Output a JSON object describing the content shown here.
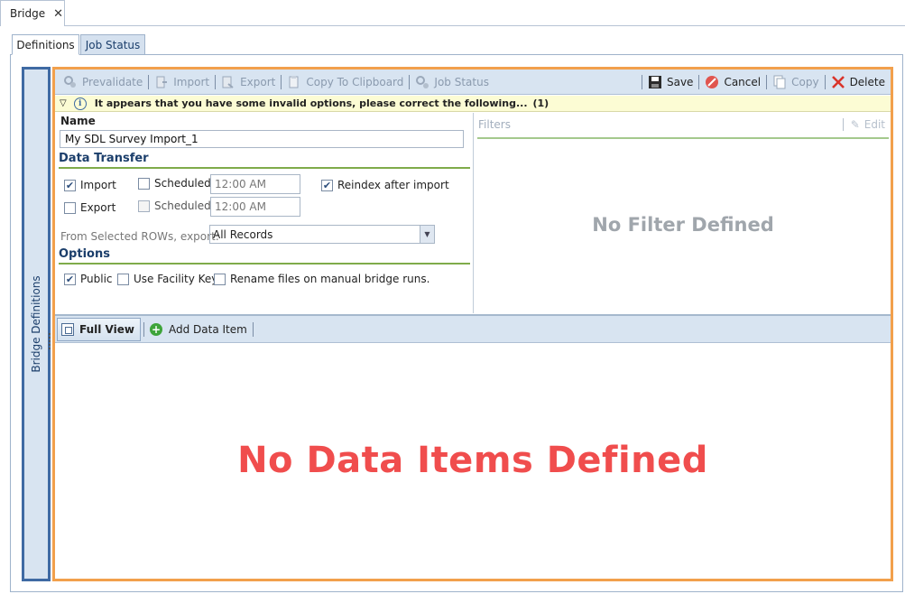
{
  "doc_tab": {
    "label": "Bridge",
    "close": "✕"
  },
  "sub_tabs": [
    {
      "label": "Definitions",
      "active": true
    },
    {
      "label": "Job Status",
      "active": false
    }
  ],
  "side_panel": {
    "label": "Bridge Definitions"
  },
  "toolbar": {
    "prevalidate": "Prevalidate",
    "import": "Import",
    "export": "Export",
    "copy_clipboard": "Copy To Clipboard",
    "job_status": "Job Status",
    "save": "Save",
    "cancel": "Cancel",
    "copy": "Copy",
    "delete": "Delete"
  },
  "warning": {
    "message": "It appears that you have some invalid options, please correct the following...",
    "count": "(1)"
  },
  "form": {
    "name_label": "Name",
    "name_value": "My SDL Survey Import_1",
    "data_transfer_header": "Data Transfer",
    "import_label": "Import",
    "import_checked": true,
    "export_label": "Export",
    "export_checked": false,
    "scheduled_label": "Scheduled",
    "scheduled_1_checked": false,
    "scheduled_2_checked": false,
    "time_1": "12:00 AM",
    "time_2": "12:00 AM",
    "reindex_label": "Reindex after import",
    "reindex_checked": true,
    "selected_rows_label": "From Selected ROWs, export:",
    "selected_rows_value": "All Records",
    "options_header": "Options",
    "public_label": "Public",
    "public_checked": true,
    "facility_key_label": "Use Facility Key",
    "facility_key_checked": false,
    "rename_label": "Rename files on manual bridge runs.",
    "rename_checked": false
  },
  "filters": {
    "header": "Filters",
    "edit_label": "Edit",
    "empty_message": "No Filter Defined"
  },
  "data_items": {
    "full_view": "Full View",
    "add_item": "Add Data Item",
    "empty_message": "No Data Items Defined"
  },
  "colors": {
    "frame_orange": "#f2a04c",
    "side_blue": "#3f6aa3",
    "toolbar_bg": "#d8e4f1",
    "section_line": "#7fab4a",
    "empty_red": "#f04d4d"
  }
}
